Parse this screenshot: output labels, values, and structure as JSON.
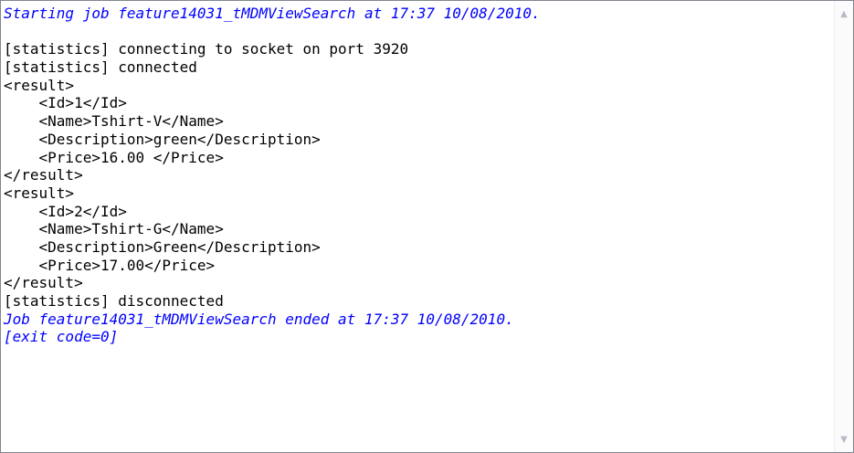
{
  "console": {
    "lines": [
      {
        "text": "Starting job feature14031_tMDMViewSearch at 17:37 10/08/2010.",
        "style": "blue"
      },
      {
        "text": "",
        "style": "normal"
      },
      {
        "text": "[statistics] connecting to socket on port 3920",
        "style": "normal"
      },
      {
        "text": "[statistics] connected",
        "style": "normal"
      },
      {
        "text": "<result>",
        "style": "normal"
      },
      {
        "text": "    <Id>1</Id>",
        "style": "normal"
      },
      {
        "text": "    <Name>Tshirt-V</Name>",
        "style": "normal"
      },
      {
        "text": "    <Description>green</Description>",
        "style": "normal"
      },
      {
        "text": "    <Price>16.00 </Price>",
        "style": "normal"
      },
      {
        "text": "</result>",
        "style": "normal"
      },
      {
        "text": "<result>",
        "style": "normal"
      },
      {
        "text": "    <Id>2</Id>",
        "style": "normal"
      },
      {
        "text": "    <Name>Tshirt-G</Name>",
        "style": "normal"
      },
      {
        "text": "    <Description>Green</Description>",
        "style": "normal"
      },
      {
        "text": "    <Price>17.00</Price>",
        "style": "normal"
      },
      {
        "text": "</result>",
        "style": "normal"
      },
      {
        "text": "[statistics] disconnected",
        "style": "normal"
      },
      {
        "text": "Job feature14031_tMDMViewSearch ended at 17:37 10/08/2010.",
        "style": "blue"
      },
      {
        "text": "[exit code=0]",
        "style": "blue"
      }
    ]
  },
  "scrollbar": {
    "up_icon": "chevron-up-icon",
    "down_icon": "chevron-down-icon"
  },
  "colors": {
    "text": "#000000",
    "job_message": "#0000ff",
    "border": "#828790"
  }
}
